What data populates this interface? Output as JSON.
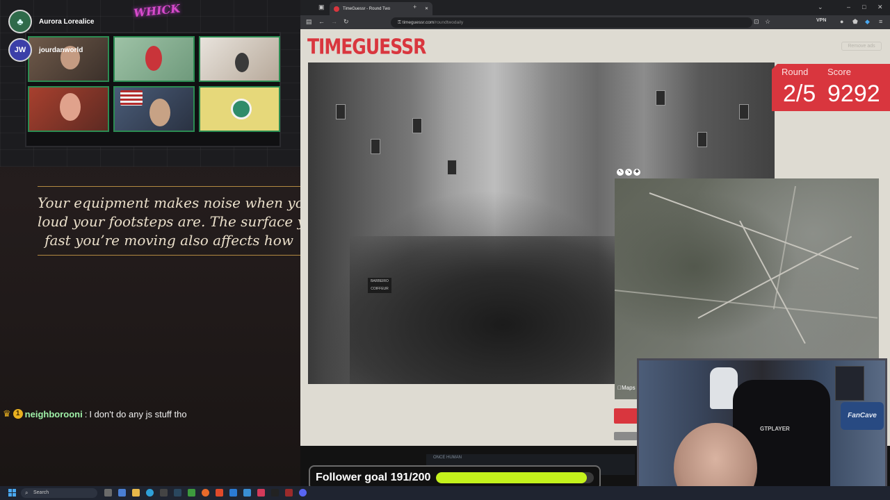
{
  "stream": {
    "voice_users": [
      {
        "name": "Aurora Lorealice",
        "avatar_icon": "tree-avatar-icon"
      },
      {
        "name": "jourdanworld",
        "avatar_icon": "jw-avatar-icon"
      }
    ],
    "neon_sign": "WHICK",
    "tip_lines": [
      "Your equipment makes noise when you m",
      "loud your footsteps are. The surface yo",
      "fast you’re moving also affects how"
    ],
    "chat": {
      "badge": "1",
      "username": "neighborooni",
      "separator": ":",
      "message": "I don't do any js stuff tho"
    },
    "follower_goal": {
      "label": "Follower goal 191/200",
      "current": 191,
      "target": 200
    }
  },
  "browser": {
    "tab_title": "TimeGuessr - Round Two",
    "url_domain": "timeguessr.com",
    "url_path": "/roundtwodaily",
    "vpn_label": "VPN"
  },
  "game": {
    "logo": "TIMEGUESSR",
    "remove_ads": "Remove ads",
    "round_label": "Round",
    "score_label": "Score",
    "round_value": "2/5",
    "score_value": "9292",
    "photo_sign": "BARBEIRO COIFFEUR",
    "maps_label": "Maps",
    "ad_text": "ONCE HUMAN"
  },
  "webcam": {
    "chair_text": "GTPLAYER",
    "badge_text": "FanCave"
  },
  "taskbar": {
    "search_placeholder": "Search"
  },
  "colors": {
    "accent_red": "#d9363e",
    "goal_fill": "#c4f21c",
    "chat_nick": "#9ff1a8",
    "tip_border": "#b48a42"
  }
}
